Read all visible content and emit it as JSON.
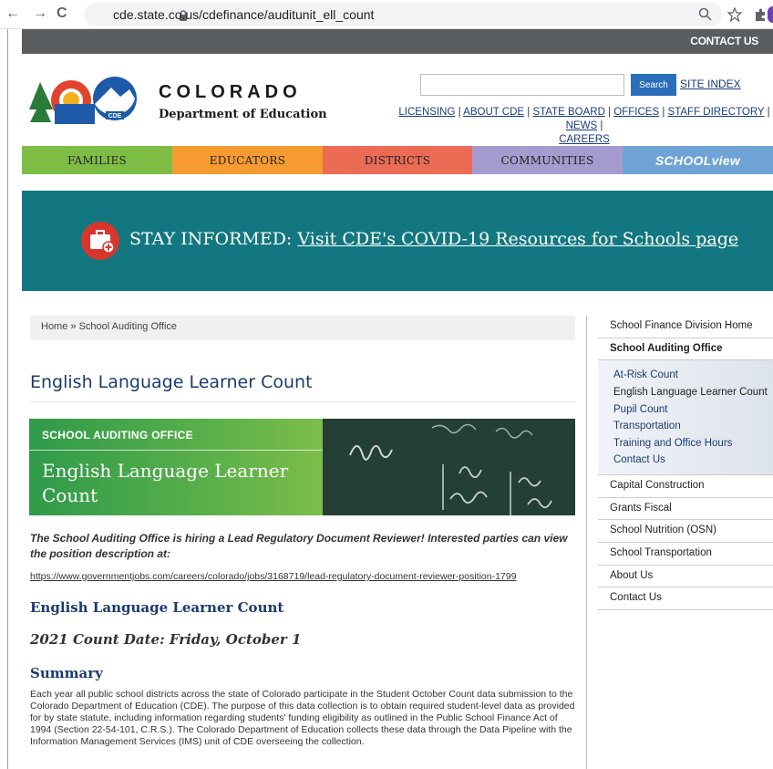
{
  "browser": {
    "url": "cde.state.co.us/cdefinance/auditunit_ell_count",
    "back": "←",
    "forward": "→",
    "reload": "C"
  },
  "header": {
    "contact_label": "CONTACT US",
    "logo_word1": "COLORADO",
    "logo_word2": "Department of Education",
    "search_placeholder": "",
    "search_label": "Search",
    "site_index": "SITE INDEX",
    "links": [
      "LICENSING",
      "ABOUT CDE",
      "STATE BOARD",
      "OFFICES",
      "STAFF DIRECTORY",
      "NEWS",
      "CAREERS"
    ]
  },
  "nav": [
    {
      "label": "FAMILIES",
      "color": "#7ebd45"
    },
    {
      "label": "EDUCATORS",
      "color": "#f59b30"
    },
    {
      "label": "DISTRICTS",
      "color": "#ec6b55"
    },
    {
      "label": "COMMUNITIES",
      "color": "#a69bcf"
    },
    {
      "label": "SCHOOLview",
      "color": "#6fa3d6"
    }
  ],
  "banner": {
    "prefix": "STAY INFORMED: ",
    "link": "Visit CDE's COVID-19 Resources for Schools page",
    "bg": "#127780"
  },
  "breadcrumb": {
    "home": "Home",
    "sep": "»",
    "current": "School Auditing Office"
  },
  "main": {
    "title": "English Language Learner Count",
    "hero_kicker": "SCHOOL AUDITING OFFICE",
    "hero_title": "English Language Learner Count",
    "notice": "The School Auditing Office is hiring a Lead Regulatory Document Reviewer! Interested parties can view the position description at:",
    "job_link": "https://www.governmentjobs.com/careers/colorado/jobs/3168719/lead-regulatory-document-reviewer-position-1799",
    "h2": "English Language Learner Count",
    "date": "2021 Count Date: Friday, October 1",
    "summary_heading": "Summary",
    "summary_text": "Each year all public school districts across the state of Colorado participate in the Student October Count data submission to the Colorado Department of Education (CDE). The purpose of this data collection is to obtain required student-level data as provided for by state statute, including information regarding students' funding eligibility as outlined in the Public School Finance Act of 1994 (Section 22-54-101, C.R.S.). The Colorado Department of Education collects these data through the Data Pipeline with the Information Management Services (IMS) unit of CDE overseeing the collection."
  },
  "sidebar": {
    "items_top": [
      "School Finance Division Home",
      "School Auditing Office"
    ],
    "sub_items": [
      "At-Risk Count",
      "English Language Learner Count",
      "Pupil Count",
      "Transportation",
      "Training and Office Hours",
      "Contact Us"
    ],
    "items_bottom": [
      "Capital Construction",
      "Grants Fiscal",
      "School Nutrition (OSN)",
      "School Transportation",
      "About Us",
      "Contact Us"
    ]
  }
}
